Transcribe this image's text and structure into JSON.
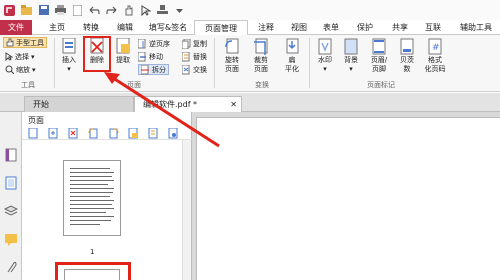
{
  "menu_tabs": {
    "file": "文件",
    "home": "主页",
    "convert": "转换",
    "edit": "编辑",
    "fill_sign": "填写&签名",
    "page_manage": "页面管理",
    "comment": "注释",
    "view": "视图",
    "form": "表单",
    "protect": "保护",
    "share": "共享",
    "connect": "互联",
    "help": "辅助工具"
  },
  "tools_group": {
    "hand": "手型工具",
    "select": "选择",
    "zoom": "缩放",
    "group_label": "工具"
  },
  "page_group": {
    "insert": "插入",
    "delete": "删除",
    "extract": "提取",
    "reverse": "逆页序",
    "move": "移动",
    "split": "拆分",
    "copy": "复制",
    "replace": "替换",
    "swap": "交换",
    "group_label": "页面"
  },
  "transform_group": {
    "rotate": [
      "旋转",
      "页面"
    ],
    "crop": [
      "裁剪",
      "页面"
    ],
    "flatten": [
      "扁",
      "平化"
    ],
    "group_label": "变换"
  },
  "marks_group": {
    "watermark": "水印",
    "background": "背景",
    "header_footer": [
      "页眉/",
      "页脚"
    ],
    "bates": [
      "贝茨",
      "数"
    ],
    "format_page_num": [
      "格式",
      "化页码"
    ],
    "group_label": "页面标记"
  },
  "doc_tabs": {
    "start": "开始",
    "current": "编辑软件.pdf *"
  },
  "pages_panel": {
    "title": "页面",
    "page_number": "1"
  },
  "colors": {
    "accent": "#c0304a",
    "highlight": "#e2231a"
  }
}
